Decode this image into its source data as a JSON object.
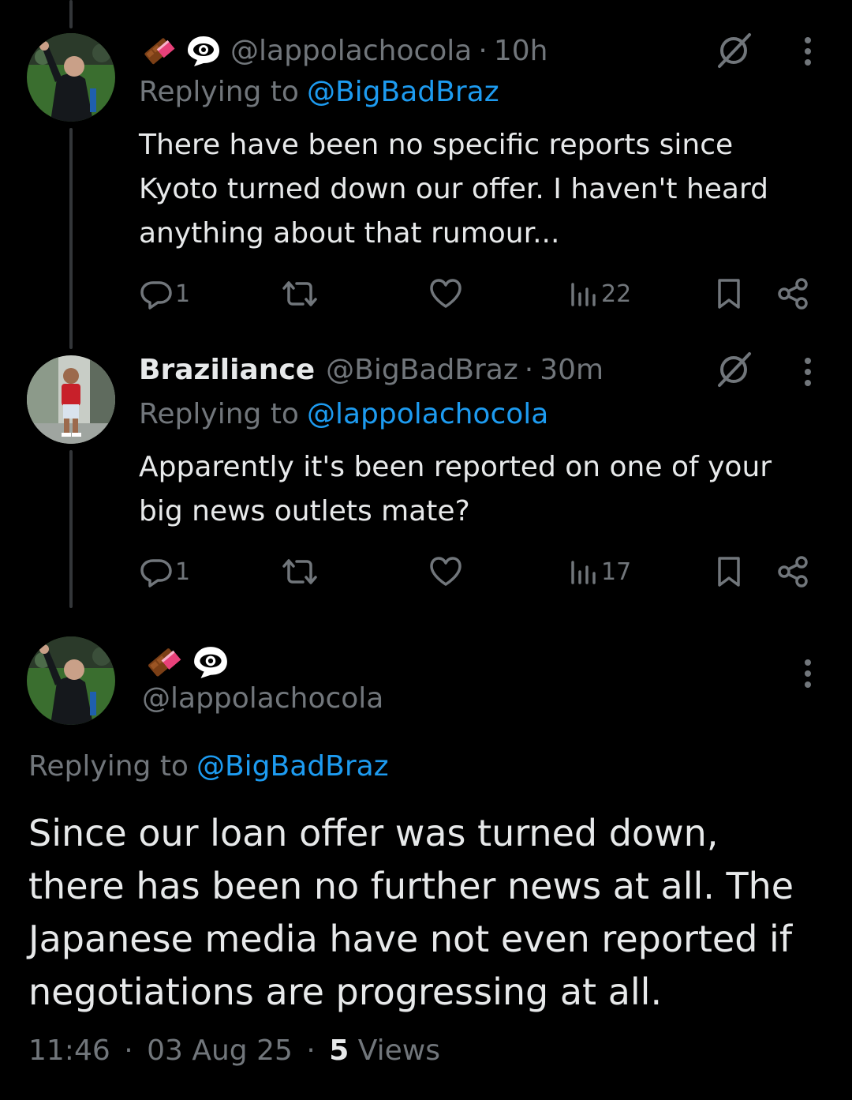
{
  "colors": {
    "background": "#000000",
    "text": "#e7e9ea",
    "muted": "#71767b",
    "link": "#1d9bf0",
    "thread_line": "#333639"
  },
  "tweets": [
    {
      "handle": "@lappolachocola",
      "sep": "·",
      "time": "10h",
      "badges": [
        "chocolate-bar-icon",
        "eye-in-speech-bubble-icon"
      ],
      "reply_prefix": "Replying to",
      "reply_to": "@BigBadBraz",
      "text": "There have been no specific reports since Kyoto turned down our offer. I haven't heard anything about that rumour...",
      "replies": "1",
      "views": "22"
    },
    {
      "display_name": "Braziliance",
      "handle": "@BigBadBraz",
      "sep": "·",
      "time": "30m",
      "reply_prefix": "Replying to",
      "reply_to": "@lappolachocola",
      "text": "Apparently it's been reported on one of your big news outlets mate?",
      "replies": "1",
      "views": "17"
    }
  ],
  "main_tweet": {
    "badges": [
      "chocolate-bar-icon",
      "eye-in-speech-bubble-icon"
    ],
    "handle": "@lappolachocola",
    "reply_prefix": "Replying to",
    "reply_to": "@BigBadBraz",
    "text": "Since our loan offer was turned down, there has been no further news at all. The Japanese media have not even reported if negotiations are progressing at all.",
    "time": "11:46",
    "date": "03 Aug 25",
    "sep": "·",
    "views_count": "5",
    "views_label": "Views"
  }
}
